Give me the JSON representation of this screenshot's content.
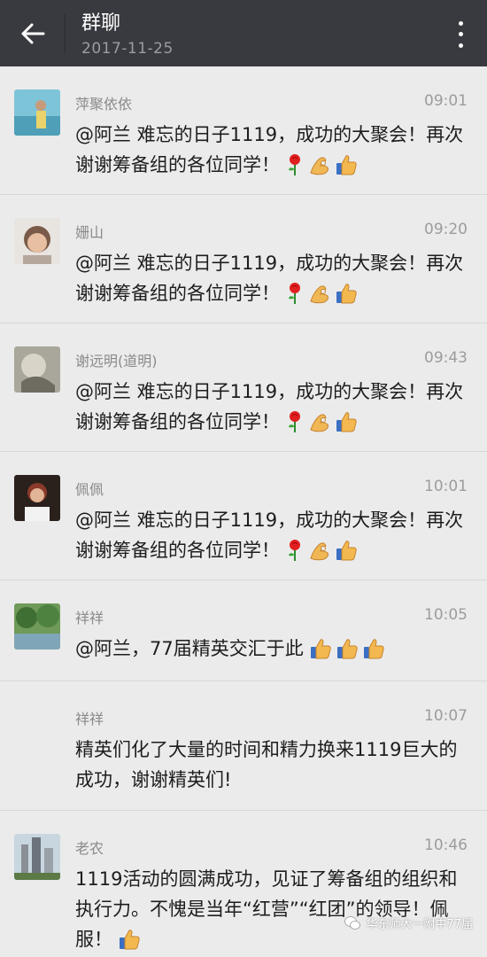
{
  "header": {
    "title": "群聊",
    "date": "2017-11-25"
  },
  "messages": [
    {
      "sender": "萍聚依依",
      "time": "09:01",
      "text": "@阿兰 难忘的日子1119，成功的大聚会！再次谢谢筹备组的各位同学！",
      "emojis": [
        "rose-emoji",
        "ok-hand-emoji",
        "thumbs-up-emoji"
      ]
    },
    {
      "sender": "姗山",
      "time": "09:20",
      "text": "@阿兰 难忘的日子1119，成功的大聚会！再次谢谢筹备组的各位同学！",
      "emojis": [
        "rose-emoji",
        "ok-hand-emoji",
        "thumbs-up-emoji"
      ]
    },
    {
      "sender": "谢远明(道明)",
      "time": "09:43",
      "text": "@阿兰 难忘的日子1119，成功的大聚会！再次谢谢筹备组的各位同学！",
      "emojis": [
        "rose-emoji",
        "ok-hand-emoji",
        "thumbs-up-emoji"
      ]
    },
    {
      "sender": "佩佩",
      "time": "10:01",
      "text": "@阿兰 难忘的日子1119，成功的大聚会！再次谢谢筹备组的各位同学！",
      "emojis": [
        "rose-emoji",
        "ok-hand-emoji",
        "thumbs-up-emoji"
      ]
    },
    {
      "sender": "祥祥",
      "time": "10:05",
      "text": "@阿兰，77届精英交汇于此",
      "emojis": [
        "thumbs-up-emoji",
        "thumbs-up-emoji",
        "thumbs-up-emoji"
      ]
    },
    {
      "sender": "祥祥",
      "time": "10:07",
      "text": "精英们化了大量的时间和精力换来1119巨大的成功，谢谢精英们!",
      "emojis": []
    },
    {
      "sender": "老农",
      "time": "10:46",
      "text": "1119活动的圆满成功，见证了筹备组的组织和执行力。不愧是当年“红营”“红团”的领导！佩服！",
      "emojis": [
        "thumbs-up-emoji"
      ]
    }
  ],
  "watermark": "华东师大一附中77届",
  "colors": {
    "header_bg": "#393a3f",
    "page_bg": "#ebebeb",
    "name": "#8a8a8a",
    "text": "#1d1d1d"
  }
}
